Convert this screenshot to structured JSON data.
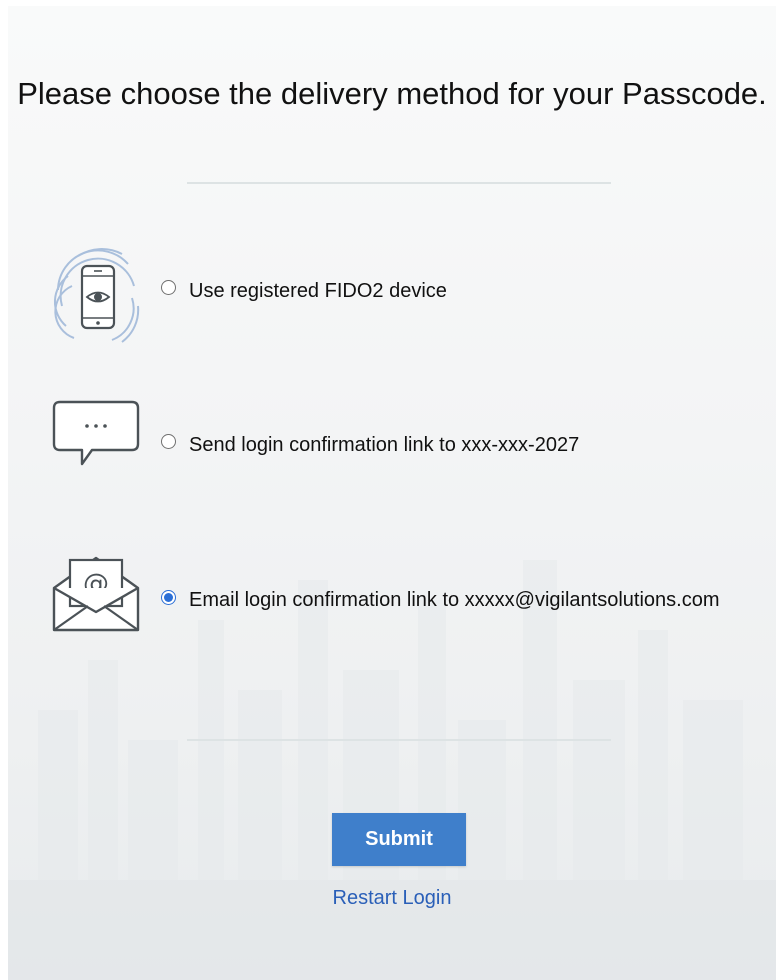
{
  "page": {
    "title": "Please choose the delivery method for your Passcode."
  },
  "options": [
    {
      "label": "Use registered FIDO2 device",
      "icon": "fingerprint-phone-icon",
      "selected": false
    },
    {
      "label": "Send login confirmation link to xxx-xxx-2027",
      "icon": "chat-bubble-icon",
      "selected": false
    },
    {
      "label": "Email login confirmation link to xxxxx@vigilantsolutions.com",
      "icon": "email-envelope-icon",
      "selected": true
    }
  ],
  "actions": {
    "submit_label": "Submit",
    "restart_label": "Restart Login"
  },
  "colors": {
    "accent": "#3f7fcb",
    "link": "#2a5fb8",
    "radio_selected": "#2b6fd6"
  }
}
